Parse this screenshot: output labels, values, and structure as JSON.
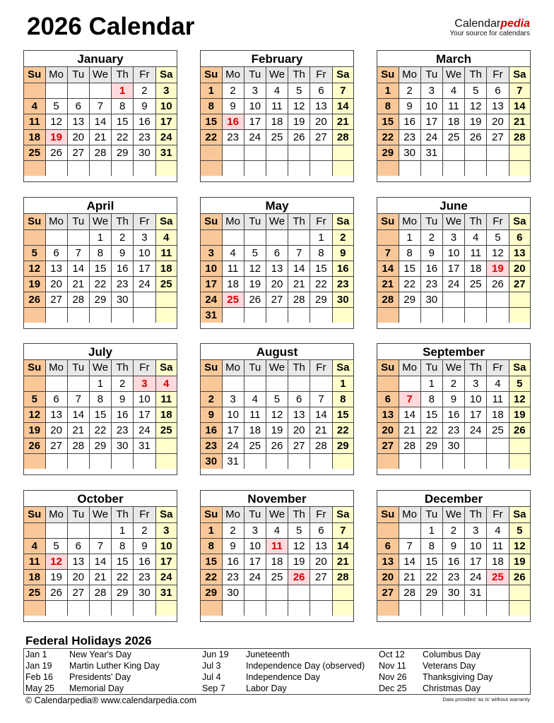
{
  "header": {
    "title": "2026 Calendar",
    "brand_name_main": "Calendar",
    "brand_name_accent": "pedia",
    "brand_tagline": "Your source for calendars"
  },
  "weekday_labels": [
    "Su",
    "Mo",
    "Tu",
    "We",
    "Th",
    "Fr",
    "Sa"
  ],
  "colors": {
    "sunday": "#fac898",
    "saturday": "#ffffcc",
    "weekday_header": "#e8e8e8",
    "holiday_bg": "#ffd9dc",
    "holiday_text": "#d40000"
  },
  "months": [
    {
      "name": "January",
      "weeks": [
        [
          "",
          "",
          "",
          "",
          1,
          2,
          3
        ],
        [
          4,
          5,
          6,
          7,
          8,
          9,
          10
        ],
        [
          11,
          12,
          13,
          14,
          15,
          16,
          17
        ],
        [
          18,
          19,
          20,
          21,
          22,
          23,
          24
        ],
        [
          25,
          26,
          27,
          28,
          29,
          30,
          31
        ],
        [
          "",
          "",
          "",
          "",
          "",
          "",
          ""
        ]
      ],
      "holidays": [
        1,
        19
      ]
    },
    {
      "name": "February",
      "weeks": [
        [
          1,
          2,
          3,
          4,
          5,
          6,
          7
        ],
        [
          8,
          9,
          10,
          11,
          12,
          13,
          14
        ],
        [
          15,
          16,
          17,
          18,
          19,
          20,
          21
        ],
        [
          22,
          23,
          24,
          25,
          26,
          27,
          28
        ],
        [
          "",
          "",
          "",
          "",
          "",
          "",
          ""
        ],
        [
          "",
          "",
          "",
          "",
          "",
          "",
          ""
        ]
      ],
      "holidays": [
        16
      ]
    },
    {
      "name": "March",
      "weeks": [
        [
          1,
          2,
          3,
          4,
          5,
          6,
          7
        ],
        [
          8,
          9,
          10,
          11,
          12,
          13,
          14
        ],
        [
          15,
          16,
          17,
          18,
          19,
          20,
          21
        ],
        [
          22,
          23,
          24,
          25,
          26,
          27,
          28
        ],
        [
          29,
          30,
          31,
          "",
          "",
          "",
          ""
        ],
        [
          "",
          "",
          "",
          "",
          "",
          "",
          ""
        ]
      ],
      "holidays": []
    },
    {
      "name": "April",
      "weeks": [
        [
          "",
          "",
          "",
          1,
          2,
          3,
          4
        ],
        [
          5,
          6,
          7,
          8,
          9,
          10,
          11
        ],
        [
          12,
          13,
          14,
          15,
          16,
          17,
          18
        ],
        [
          19,
          20,
          21,
          22,
          23,
          24,
          25
        ],
        [
          26,
          27,
          28,
          29,
          30,
          "",
          ""
        ],
        [
          "",
          "",
          "",
          "",
          "",
          "",
          ""
        ]
      ],
      "holidays": []
    },
    {
      "name": "May",
      "weeks": [
        [
          "",
          "",
          "",
          "",
          "",
          1,
          2
        ],
        [
          3,
          4,
          5,
          6,
          7,
          8,
          9
        ],
        [
          10,
          11,
          12,
          13,
          14,
          15,
          16
        ],
        [
          17,
          18,
          19,
          20,
          21,
          22,
          23
        ],
        [
          24,
          25,
          26,
          27,
          28,
          29,
          30
        ],
        [
          31,
          "",
          "",
          "",
          "",
          "",
          ""
        ]
      ],
      "holidays": [
        25
      ]
    },
    {
      "name": "June",
      "weeks": [
        [
          "",
          1,
          2,
          3,
          4,
          5,
          6
        ],
        [
          7,
          8,
          9,
          10,
          11,
          12,
          13
        ],
        [
          14,
          15,
          16,
          17,
          18,
          19,
          20
        ],
        [
          21,
          22,
          23,
          24,
          25,
          26,
          27
        ],
        [
          28,
          29,
          30,
          "",
          "",
          "",
          ""
        ],
        [
          "",
          "",
          "",
          "",
          "",
          "",
          ""
        ]
      ],
      "holidays": [
        19
      ]
    },
    {
      "name": "July",
      "weeks": [
        [
          "",
          "",
          "",
          1,
          2,
          3,
          4
        ],
        [
          5,
          6,
          7,
          8,
          9,
          10,
          11
        ],
        [
          12,
          13,
          14,
          15,
          16,
          17,
          18
        ],
        [
          19,
          20,
          21,
          22,
          23,
          24,
          25
        ],
        [
          26,
          27,
          28,
          29,
          30,
          31,
          ""
        ],
        [
          "",
          "",
          "",
          "",
          "",
          "",
          ""
        ]
      ],
      "holidays": [
        3,
        4
      ]
    },
    {
      "name": "August",
      "weeks": [
        [
          "",
          "",
          "",
          "",
          "",
          "",
          1
        ],
        [
          2,
          3,
          4,
          5,
          6,
          7,
          8
        ],
        [
          9,
          10,
          11,
          12,
          13,
          14,
          15
        ],
        [
          16,
          17,
          18,
          19,
          20,
          21,
          22
        ],
        [
          23,
          24,
          25,
          26,
          27,
          28,
          29
        ],
        [
          30,
          31,
          "",
          "",
          "",
          "",
          ""
        ]
      ],
      "holidays": []
    },
    {
      "name": "September",
      "weeks": [
        [
          "",
          "",
          1,
          2,
          3,
          4,
          5
        ],
        [
          6,
          7,
          8,
          9,
          10,
          11,
          12
        ],
        [
          13,
          14,
          15,
          16,
          17,
          18,
          19
        ],
        [
          20,
          21,
          22,
          23,
          24,
          25,
          26
        ],
        [
          27,
          28,
          29,
          30,
          "",
          "",
          ""
        ],
        [
          "",
          "",
          "",
          "",
          "",
          "",
          ""
        ]
      ],
      "holidays": [
        7
      ]
    },
    {
      "name": "October",
      "weeks": [
        [
          "",
          "",
          "",
          "",
          1,
          2,
          3
        ],
        [
          4,
          5,
          6,
          7,
          8,
          9,
          10
        ],
        [
          11,
          12,
          13,
          14,
          15,
          16,
          17
        ],
        [
          18,
          19,
          20,
          21,
          22,
          23,
          24
        ],
        [
          25,
          26,
          27,
          28,
          29,
          30,
          31
        ],
        [
          "",
          "",
          "",
          "",
          "",
          "",
          ""
        ]
      ],
      "holidays": [
        12
      ]
    },
    {
      "name": "November",
      "weeks": [
        [
          1,
          2,
          3,
          4,
          5,
          6,
          7
        ],
        [
          8,
          9,
          10,
          11,
          12,
          13,
          14
        ],
        [
          15,
          16,
          17,
          18,
          19,
          20,
          21
        ],
        [
          22,
          23,
          24,
          25,
          26,
          27,
          28
        ],
        [
          29,
          30,
          "",
          "",
          "",
          "",
          ""
        ],
        [
          "",
          "",
          "",
          "",
          "",
          "",
          ""
        ]
      ],
      "holidays": [
        11,
        26
      ]
    },
    {
      "name": "December",
      "weeks": [
        [
          "",
          "",
          1,
          2,
          3,
          4,
          5
        ],
        [
          6,
          7,
          8,
          9,
          10,
          11,
          12
        ],
        [
          13,
          14,
          15,
          16,
          17,
          18,
          19
        ],
        [
          20,
          21,
          22,
          23,
          24,
          25,
          26
        ],
        [
          27,
          28,
          29,
          30,
          31,
          "",
          ""
        ],
        [
          "",
          "",
          "",
          "",
          "",
          "",
          ""
        ]
      ],
      "holidays": [
        25
      ]
    }
  ],
  "holidays_section": {
    "title": "Federal Holidays 2026",
    "items": [
      {
        "date": "Jan 1",
        "name": "New Year's Day"
      },
      {
        "date": "Jan 19",
        "name": "Martin Luther King Day"
      },
      {
        "date": "Feb 16",
        "name": "Presidents' Day"
      },
      {
        "date": "May 25",
        "name": "Memorial Day"
      },
      {
        "date": "Jun 19",
        "name": "Juneteenth"
      },
      {
        "date": "Jul 3",
        "name": "Independence Day (observed)"
      },
      {
        "date": "Jul 4",
        "name": "Independence Day"
      },
      {
        "date": "Sep 7",
        "name": "Labor Day"
      },
      {
        "date": "Oct 12",
        "name": "Columbus Day"
      },
      {
        "date": "Nov 11",
        "name": "Veterans Day"
      },
      {
        "date": "Nov 26",
        "name": "Thanksgiving Day"
      },
      {
        "date": "Dec 25",
        "name": "Christmas Day"
      }
    ]
  },
  "footer": {
    "copyright": "© Calendarpedia®   www.calendarpedia.com",
    "disclaimer": "Data provided 'as is' without warranty"
  }
}
